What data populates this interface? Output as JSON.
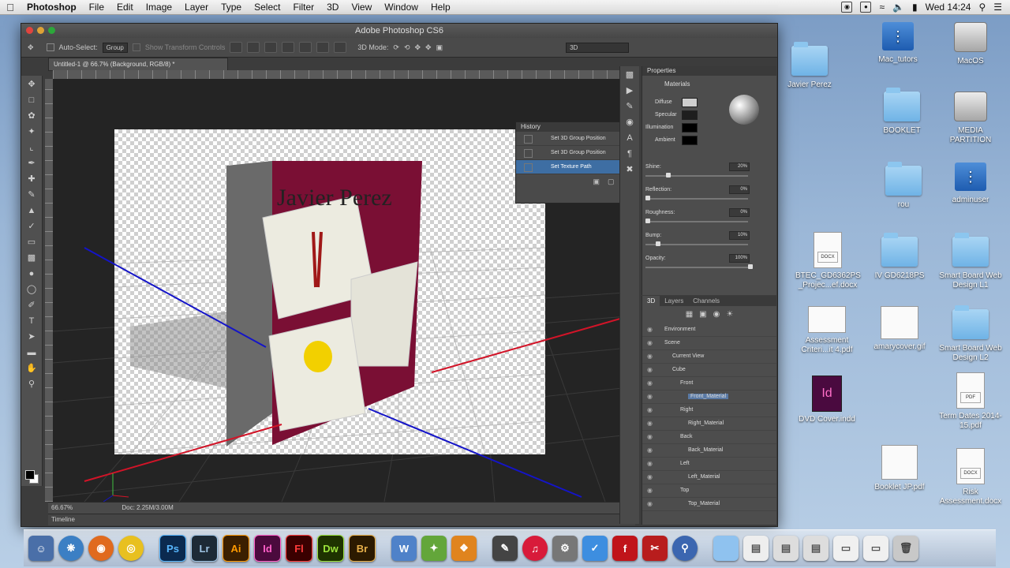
{
  "menubar": {
    "app": "Photoshop",
    "items": [
      "File",
      "Edit",
      "Image",
      "Layer",
      "Type",
      "Select",
      "Filter",
      "3D",
      "View",
      "Window",
      "Help"
    ],
    "clock": "Wed 14:24"
  },
  "window": {
    "title": "Adobe Photoshop CS6"
  },
  "options": {
    "auto_select": "Auto-Select:",
    "group": "Group",
    "transform": "Show Transform Controls",
    "mode": "3D Mode:",
    "workspace": "3D"
  },
  "document": {
    "tab": "Untitled-1 @ 66.7% (Background, RGB/8) *",
    "zoom": "66.67%",
    "doc_info": "Doc: 2.25M/3.00M",
    "timeline": "Timeline"
  },
  "box_text": "Javier Perez",
  "history": {
    "title": "History",
    "items": [
      "Set 3D Group Position",
      "Set 3D Group Position",
      "Set Texture Path"
    ],
    "selected": 2
  },
  "properties": {
    "title": "Properties",
    "section": "Materials",
    "swatches": [
      {
        "label": "Diffuse",
        "color": "#cfcfcf"
      },
      {
        "label": "Specular",
        "color": "#1e1e1e"
      },
      {
        "label": "Illumination",
        "color": "#000000"
      },
      {
        "label": "Ambient",
        "color": "#000000"
      }
    ],
    "sliders": [
      {
        "label": "Shine:",
        "value": "20%",
        "fraction": 0.2
      },
      {
        "label": "Reflection:",
        "value": "0%",
        "fraction": 0.0
      },
      {
        "label": "Roughness:",
        "value": "0%",
        "fraction": 0.0
      },
      {
        "label": "Bump:",
        "value": "10%",
        "fraction": 0.1
      },
      {
        "label": "Opacity:",
        "value": "100%",
        "fraction": 1.0
      }
    ]
  },
  "panel3d": {
    "tabs": [
      "3D",
      "Layers",
      "Channels"
    ],
    "rows": [
      {
        "label": "Environment",
        "indent": 0
      },
      {
        "label": "Scene",
        "indent": 0
      },
      {
        "label": "Current View",
        "indent": 1
      },
      {
        "label": "Cube",
        "indent": 1
      },
      {
        "label": "Front",
        "indent": 2
      },
      {
        "label": "Front_Material",
        "indent": 3,
        "selected": true
      },
      {
        "label": "Right",
        "indent": 2
      },
      {
        "label": "Right_Material",
        "indent": 3
      },
      {
        "label": "Back",
        "indent": 2
      },
      {
        "label": "Back_Material",
        "indent": 3
      },
      {
        "label": "Left",
        "indent": 2
      },
      {
        "label": "Left_Material",
        "indent": 3
      },
      {
        "label": "Top",
        "indent": 2
      },
      {
        "label": "Top_Material",
        "indent": 3
      }
    ]
  },
  "desktop": {
    "javier": "Javier Perez",
    "mac_tutors": "Mac_tutors",
    "macos": "MacOS",
    "booklet": "BOOKLET",
    "media": "MEDIA PARTITION",
    "rou": "rou",
    "adminuser": "adminuser",
    "btec": "BTEC_GD6362PS _Projec...ef.docx",
    "ivgd": "IV GD6218PS",
    "smart1": "Smart Board Web Design L1",
    "assess": "Assessment Criteri...it 4.pdf",
    "amary": "amarycover.gif",
    "smart2": "Smart Board Web Design L2",
    "dvd": "DVD Cover.indd",
    "term": "Term Dates 2014-15.pdf",
    "bookletjp": "Booklet JP.pdf",
    "risk": "Risk Assessment.docx",
    "docx_tag": "DOCX",
    "pdf_tag": "PDF",
    "indd_tag": "INDD"
  },
  "dock": {
    "apps": [
      {
        "name": "Ps",
        "color": "#0b2a4f",
        "fg": "#58b7ff"
      },
      {
        "name": "Lr",
        "color": "#1d2a36",
        "fg": "#9fc4e4"
      },
      {
        "name": "Ai",
        "color": "#3b1f00",
        "fg": "#ff9a00"
      },
      {
        "name": "Id",
        "color": "#4b0a3d",
        "fg": "#ff5fc8"
      },
      {
        "name": "Fl",
        "color": "#3a0000",
        "fg": "#ff3b3b"
      },
      {
        "name": "Dw",
        "color": "#1e3300",
        "fg": "#9be33b"
      },
      {
        "name": "Br",
        "color": "#2c1a00",
        "fg": "#e8b04a"
      }
    ]
  }
}
